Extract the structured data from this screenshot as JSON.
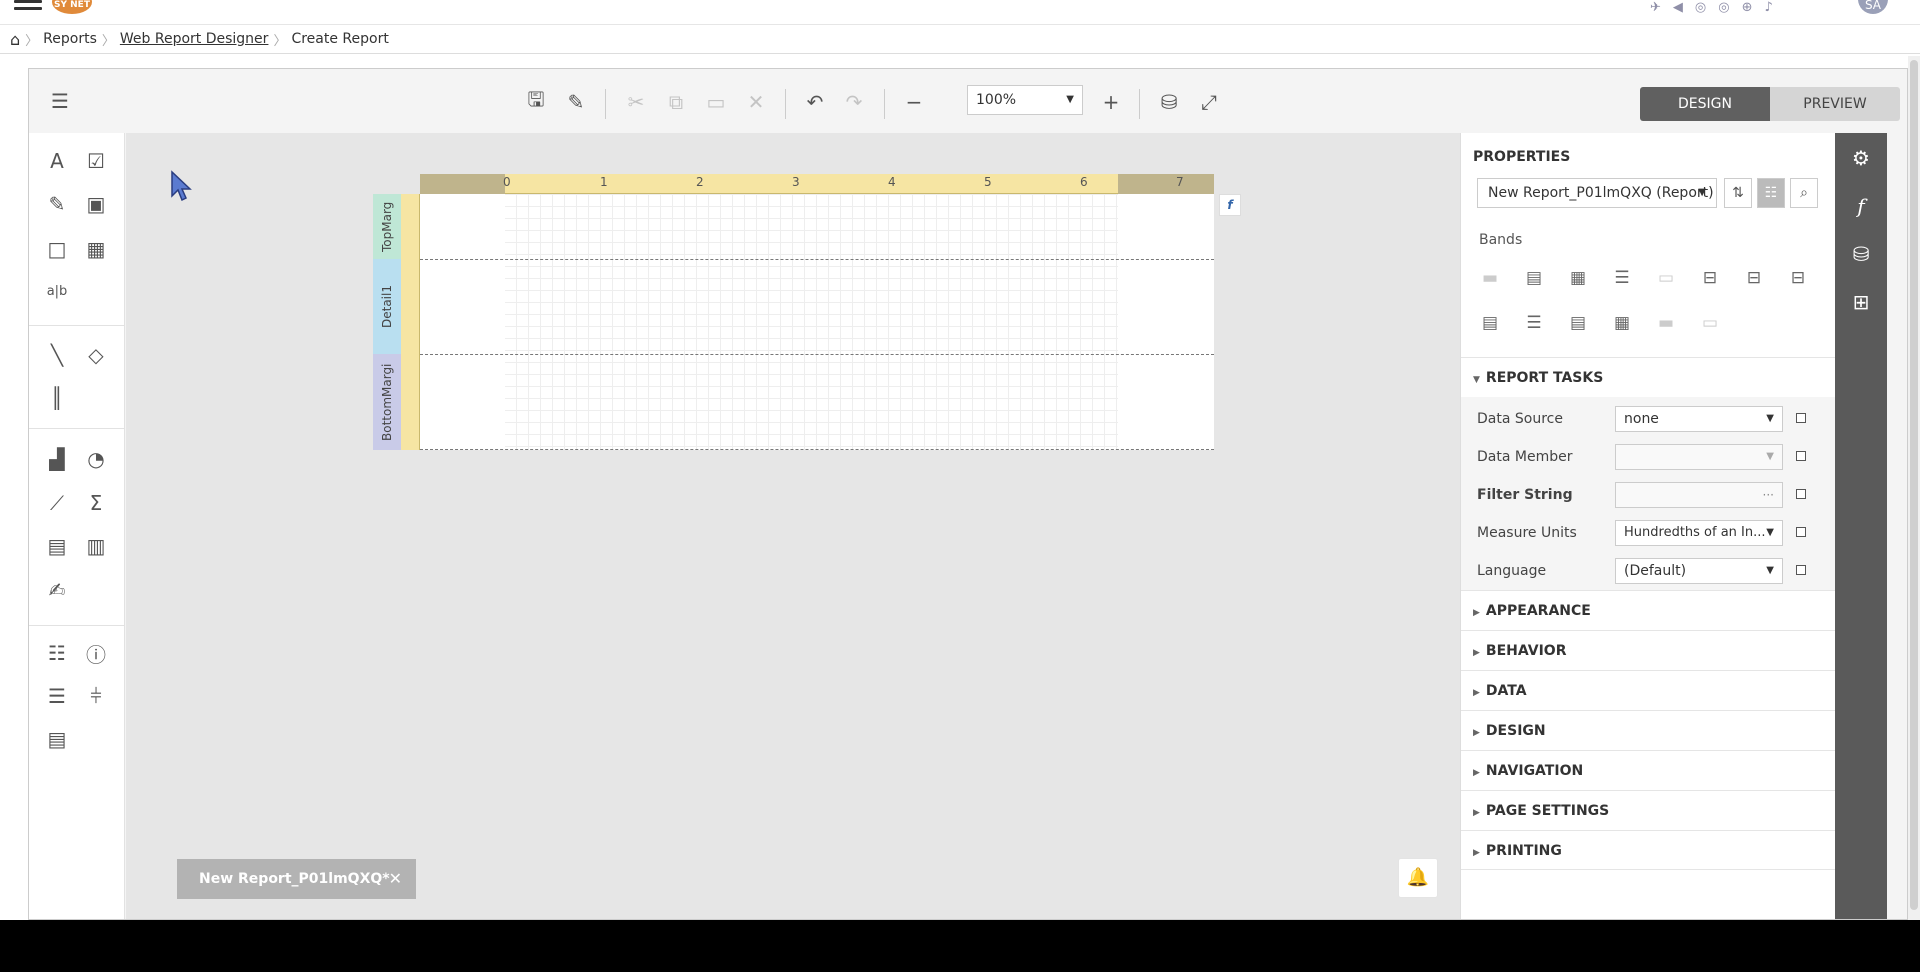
{
  "breadcrumb": {
    "home_icon": "home-icon",
    "items": [
      "Reports",
      "Web Report Designer",
      "Create Report"
    ]
  },
  "topbar": {
    "avatar": "SA",
    "logo": "SY NET"
  },
  "toolbar": {
    "zoom_value": "100%",
    "design_label": "DESIGN",
    "preview_label": "PREVIEW"
  },
  "ruler": {
    "ticks": [
      "0",
      "1",
      "2",
      "3",
      "4",
      "5",
      "6",
      "7"
    ]
  },
  "bands": {
    "top": "TopMarg",
    "detail": "Detail1",
    "bottom": "BottomMargi"
  },
  "document_tab": {
    "label": "New Report_P01lmQXQ*",
    "close": "✕"
  },
  "properties": {
    "title": "PROPERTIES",
    "selector_value": "New Report_P01lmQXQ (Report)",
    "bands_label": "Bands",
    "report_tasks": "REPORT TASKS",
    "tasks": [
      {
        "label": "Data Source",
        "value": "none"
      },
      {
        "label": "Data Member",
        "value": ""
      },
      {
        "label": "Filter String",
        "value": "···"
      },
      {
        "label": "Measure Units",
        "value": "Hundredths of an In..."
      },
      {
        "label": "Language",
        "value": "(Default)"
      }
    ],
    "sections": [
      "APPEARANCE",
      "BEHAVIOR",
      "DATA",
      "DESIGN",
      "NAVIGATION",
      "PAGE SETTINGS",
      "PRINTING"
    ]
  }
}
